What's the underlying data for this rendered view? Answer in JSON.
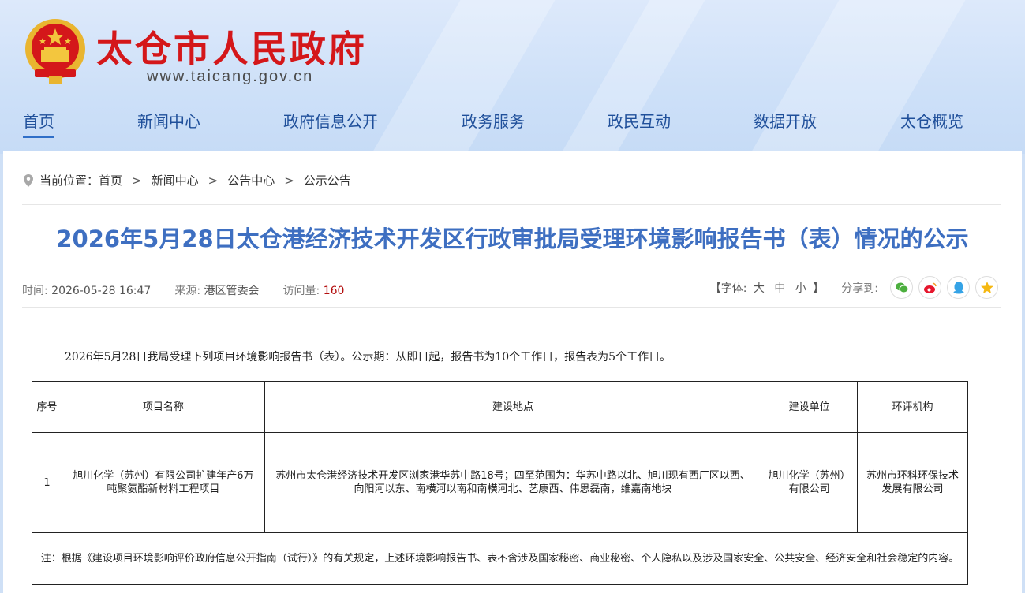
{
  "header": {
    "site_title": "太仓市人民政府",
    "site_url": "www.taicang.gov.cn"
  },
  "nav": {
    "items": [
      "首页",
      "新闻中心",
      "政府信息公开",
      "政务服务",
      "政民互动",
      "数据开放",
      "太仓概览"
    ],
    "active": "首页"
  },
  "breadcrumb": {
    "label": "当前位置：",
    "items": [
      "首页",
      "新闻中心",
      "公告中心",
      "公示公告"
    ],
    "separator": ">"
  },
  "article": {
    "title": "2026年5月28日太仓港经济技术开发区行政审批局受理环境影响报告书（表）情况的公示",
    "time_label": "时间:",
    "time": "2026-05-28 16:47",
    "source_label": "来源:",
    "source": "港区管委会",
    "views_label": "访问量:",
    "views": "160",
    "intro": "2026年5月28日我局受理下列项目环境影响报告书（表）。公示期：从即日起，报告书为10个工作日，报告表为5个工作日。"
  },
  "tools": {
    "font_open": "【字体:",
    "font_large": "大",
    "font_medium": "中",
    "font_small": "小",
    "font_close": "】",
    "share_label": "分享到:",
    "share_icons": [
      "wechat-icon",
      "weibo-icon",
      "qq-icon",
      "qzone-icon"
    ]
  },
  "table": {
    "headers": [
      "序号",
      "项目名称",
      "建设地点",
      "建设单位",
      "环评机构"
    ],
    "rows": [
      {
        "no": "1",
        "name": "旭川化学（苏州）有限公司扩建年产6万 吨聚氨酯新材料工程项目",
        "location": "苏州市太仓港经济技术开发区浏家港华苏中路18号；四至范围为：华苏中路以北、旭川现有西厂区以西、向阳河以东、南横河以南和南横河北、艺康西、伟思磊南，维嘉南地块",
        "builder": "旭川化学（苏州）有限公司",
        "agency": "苏州市环科环保技术发展有限公司"
      }
    ],
    "note": "注：根据《建设项目环境影响评价政府信息公开指南（试行）》的有关规定，上述环境影响报告书、表不含涉及国家秘密、商业秘密、个人隐私以及涉及国家安全、公共安全、经济安全和社会稳定的内容。"
  },
  "colors": {
    "brand_red": "#d4171a",
    "nav_blue": "#1f4f9a",
    "title_blue": "#3e6fc1",
    "views_red": "#b30e0e"
  }
}
